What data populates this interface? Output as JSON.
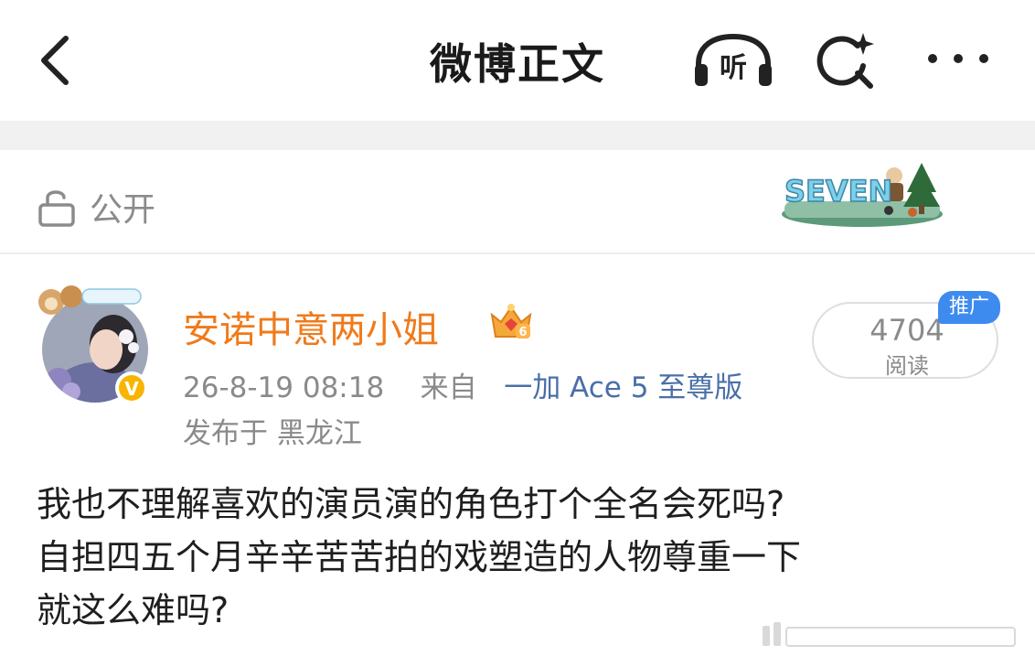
{
  "header": {
    "title": "微博正文",
    "listen_label": "听",
    "icons": [
      "back-chevron-icon",
      "listen-headphones-icon",
      "search-sparkle-icon",
      "more-dots-icon"
    ]
  },
  "visibility": {
    "label": "公开",
    "icon": "lock-open-icon",
    "sticker_text": "SEVEN"
  },
  "post": {
    "username": "安诺中意两小姐",
    "username_color": "#f07a1a",
    "member_badge": "6",
    "verified_icon": "v-badge-icon",
    "timestamp": "26-8-19 08:18",
    "source_prefix": "来自",
    "device": "一加 Ace 5 至尊版",
    "location": "发布于 黑龙江",
    "read_count": "4704",
    "read_label": "阅读",
    "promo_tag": "推广",
    "body_lines": [
      "我也不理解喜欢的演员演的角色打个全名会死吗?",
      "自担四五个月辛辛苦苦拍的戏塑造的人物尊重一下",
      "就这么难吗?"
    ]
  },
  "colors": {
    "accent_orange": "#f07a1a",
    "link_blue": "#4a6fa8",
    "promo_blue": "#3d8bef",
    "muted_gray": "#8a8a8a"
  }
}
